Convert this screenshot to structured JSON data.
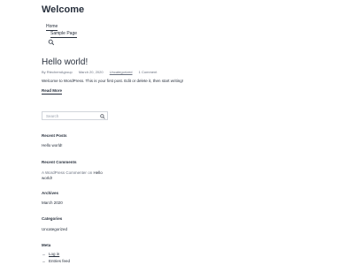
{
  "site": {
    "title": "Welcome"
  },
  "nav": {
    "home": "Home",
    "sample": "Sample Page"
  },
  "post": {
    "title": "Hello world!",
    "author": "By RtechemAgroup",
    "date": "March 20, 2020",
    "category": "Uncategorized",
    "comments": "1 Comment",
    "body": "Welcome to WordPress. This is your first post. Edit or delete it, then start writing!",
    "read_more": "Read More"
  },
  "search": {
    "placeholder": "Search"
  },
  "widgets": {
    "recent_posts_title": "Recent Posts",
    "recent_post_item": "Hello world!",
    "recent_comments_title": "Recent Comments",
    "comment_author": "A WordPress Commenter",
    "comment_on": "on",
    "comment_post_line1": "Hello",
    "comment_post_line2": "world!",
    "archives_title": "Archives",
    "archive_item": "March 2020",
    "categories_title": "Categories",
    "category_item": "Uncategorized",
    "meta_title": "Meta",
    "meta_login": "Log in",
    "meta_entries": "Entries feed"
  },
  "icons": {
    "nav_search": "search-icon",
    "search_button": "search-icon",
    "meta_arrow": "arrow-right-icon"
  }
}
